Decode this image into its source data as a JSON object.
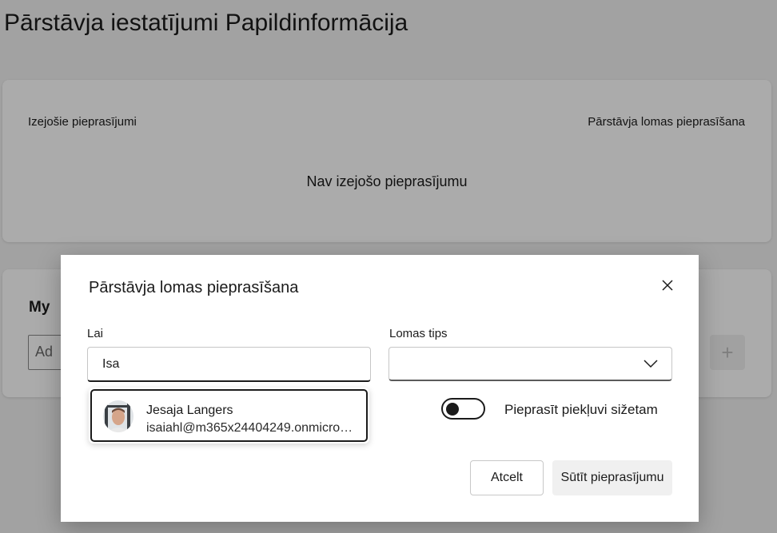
{
  "page": {
    "title": "Pārstāvja iestatījumi Papildinformācija"
  },
  "requests_card": {
    "outgoing_label": "Izejošie pieprasījumi",
    "request_role_link": "Pārstāvja lomas pieprasīšana",
    "empty_message": "Nav izejošo pieprasījumu"
  },
  "my_card": {
    "title": "My",
    "add_placeholder": "Ad",
    "plus_symbol": "+"
  },
  "dialog": {
    "title": "Pārstāvja lomas pieprasīšana",
    "to_label": "Lai",
    "to_value": "Isa",
    "role_label": "Lomas tips",
    "role_value": "",
    "toggle_label": "Pieprasīt piekļuvi sižetam",
    "toggle_on": false,
    "cancel_label": "Atcelt",
    "send_label": "Sūtīt pieprasījumu"
  },
  "suggestion": {
    "name": "Jesaja Langers",
    "email": "isaiahl@m365x24404249.onmicrosoft.com"
  },
  "icons": {
    "close": "close-icon",
    "chevron": "chevron-down-icon",
    "plus": "plus-icon"
  }
}
